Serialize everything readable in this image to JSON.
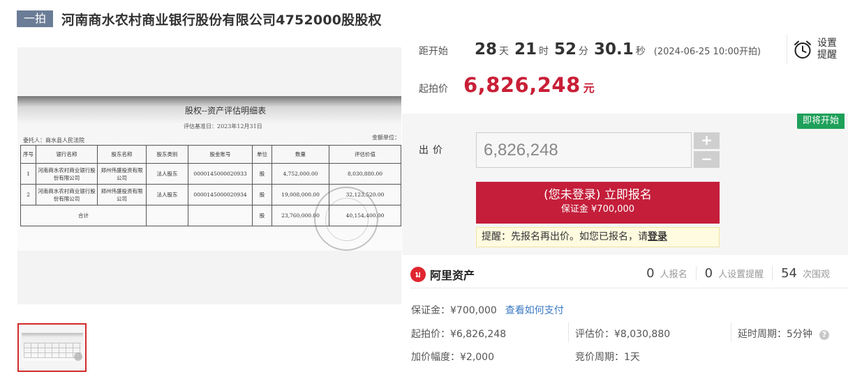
{
  "header": {
    "badge": "一拍",
    "title": "河南商水农村商业银行股份有限公司4752000股股权"
  },
  "gallery": {
    "doc_title": "股权--资产评估明细表",
    "doc_date": "评估基准日：2023年12月31日",
    "doc_client": "委托人：商水县人民法院",
    "doc_unit": "金额单位：",
    "table_headers": [
      "序号",
      "银行名称",
      "股东名称",
      "股东类别",
      "股金账号",
      "单位",
      "数量",
      "评估价值"
    ],
    "table_rows": [
      [
        "1",
        "河南商水农村商业银行股份有限公司",
        "郑州伟盛投资有限公司",
        "法人股东",
        "0000145000020933",
        "股",
        "4,752,000.00",
        "8,030,880.00"
      ],
      [
        "2",
        "河南商水农村商业银行股份有限公司",
        "郑州伟盛投资有限公司",
        "法人股东",
        "0000145000020934",
        "股",
        "19,008,000.00",
        "32,123,520.00"
      ]
    ],
    "total_row": [
      "合计",
      "股",
      "23,760,000.00",
      "40,154,400.00"
    ]
  },
  "countdown": {
    "label": "距开始",
    "days": "28",
    "days_unit": "天",
    "hours": "21",
    "hours_unit": "时",
    "minutes": "52",
    "minutes_unit": "分",
    "seconds": "30.1",
    "seconds_unit": "秒",
    "start_time": "(2024-06-25 10:00开拍)"
  },
  "reminder": {
    "label": "设置提醒"
  },
  "start_price": {
    "label": "起拍价",
    "value": "6,826,248",
    "unit": "元"
  },
  "bid": {
    "status_tag": "即将开始",
    "label": "出价",
    "input_value": "6,826,248",
    "plus": "+",
    "minus": "−",
    "signup_main": "(您未登录) 立即报名",
    "signup_sub": "保证金 ¥700,000",
    "notice_text": "提醒：先报名再出价。如您已报名，请",
    "notice_link": "登录"
  },
  "platform": {
    "logo_glyph": "ม",
    "name": "阿里资产"
  },
  "stats": [
    {
      "num": "0",
      "label": "人报名"
    },
    {
      "num": "0",
      "label": "人设置提醒"
    },
    {
      "num": "54",
      "label": "次围观"
    }
  ],
  "details": {
    "deposit": "保证金：¥700,000",
    "deposit_link": "查看如何支付",
    "start_price": "起拍价：¥6,826,248",
    "appraisal": "评估价：¥8,030,880",
    "delay_period": "延时周期：5分钟",
    "increment": "加价幅度：¥2,000",
    "bid_period": "竞价周期：1天",
    "help": "?"
  }
}
